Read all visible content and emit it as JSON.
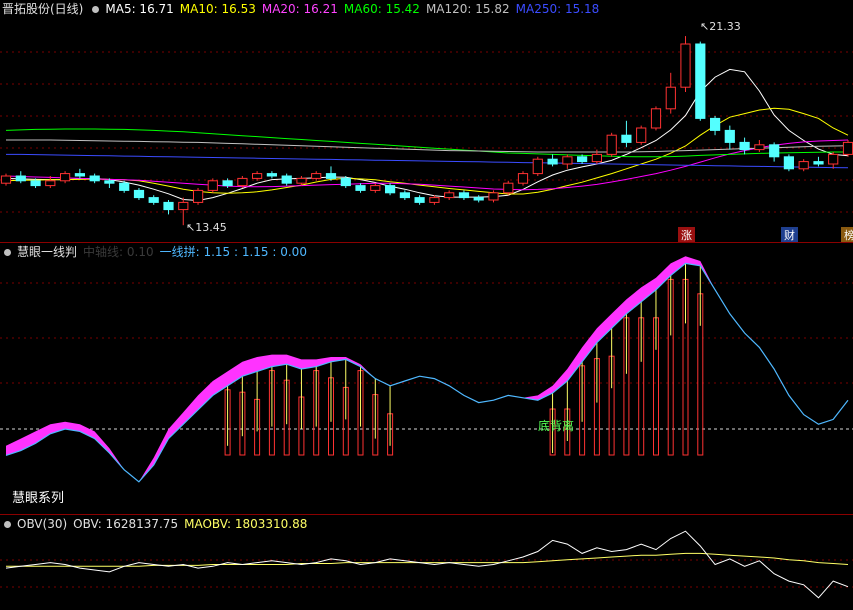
{
  "colors": {
    "up": "#ff3232",
    "down": "#54ffff",
    "ma5": "#ffffff",
    "ma10": "#ffff00",
    "ma20": "#ff00ff",
    "ma60": "#00ff00",
    "ma120": "#c0c0c0",
    "ma250": "#3b4cff",
    "obv": "#ffffff",
    "maobv": "#ffff66",
    "band": "#ff33ff",
    "ind_line": "#4fb8ff"
  },
  "main": {
    "stock_name": "晋拓股份(日线)",
    "indicators": [
      {
        "label": "MA5: 16.71",
        "color": "#ffffff"
      },
      {
        "label": "MA10: 16.53",
        "color": "#ffff00"
      },
      {
        "label": "MA20: 16.21",
        "color": "#ff44ff"
      },
      {
        "label": "MA60: 15.42",
        "color": "#00ff00"
      },
      {
        "label": "MA120: 15.82",
        "color": "#c0c0c0"
      },
      {
        "label": "MA250: 15.18",
        "color": "#3b4cff"
      }
    ],
    "high_label": "21.33",
    "low_label": "13.45",
    "tags": [
      "涨",
      "财",
      "榜"
    ]
  },
  "indicator": {
    "title": "慧眼一线判",
    "faded": "中轴线: 0.10",
    "value": "一线拼: 1.15 : 1.15 : 0.00",
    "signal": "底背离",
    "series_label": "慧眼系列"
  },
  "obv": {
    "title": "OBV(30)",
    "obv_value": "OBV: 1628137.75",
    "maobv_value": "MAOBV: 1803310.88"
  },
  "chart_data": {
    "type": "candlestick",
    "price_range": [
      13.0,
      22.0
    ],
    "candles": [
      [
        15.2,
        15.5,
        15.6,
        15.1
      ],
      [
        15.5,
        15.3,
        15.7,
        15.2
      ],
      [
        15.3,
        15.1,
        15.4,
        15.0
      ],
      [
        15.1,
        15.3,
        15.5,
        15.0
      ],
      [
        15.3,
        15.6,
        15.7,
        15.2
      ],
      [
        15.6,
        15.5,
        15.8,
        15.4
      ],
      [
        15.5,
        15.3,
        15.6,
        15.2
      ],
      [
        15.3,
        15.2,
        15.4,
        15.0
      ],
      [
        15.2,
        14.9,
        15.3,
        14.8
      ],
      [
        14.9,
        14.6,
        15.0,
        14.5
      ],
      [
        14.6,
        14.4,
        14.7,
        14.3
      ],
      [
        14.4,
        14.1,
        14.5,
        13.9
      ],
      [
        14.1,
        14.4,
        14.6,
        13.45
      ],
      [
        14.4,
        14.9,
        15.0,
        14.3
      ],
      [
        14.9,
        15.3,
        15.4,
        14.8
      ],
      [
        15.3,
        15.1,
        15.4,
        15.0
      ],
      [
        15.1,
        15.4,
        15.5,
        15.0
      ],
      [
        15.4,
        15.6,
        15.7,
        15.3
      ],
      [
        15.6,
        15.5,
        15.7,
        15.4
      ],
      [
        15.5,
        15.2,
        15.6,
        15.1
      ],
      [
        15.2,
        15.4,
        15.5,
        15.1
      ],
      [
        15.4,
        15.6,
        15.7,
        15.3
      ],
      [
        15.6,
        15.4,
        15.9,
        15.3
      ],
      [
        15.4,
        15.1,
        15.5,
        15.0
      ],
      [
        15.1,
        14.9,
        15.2,
        14.8
      ],
      [
        14.9,
        15.1,
        15.2,
        14.8
      ],
      [
        15.1,
        14.8,
        15.2,
        14.7
      ],
      [
        14.8,
        14.6,
        14.9,
        14.5
      ],
      [
        14.6,
        14.4,
        14.7,
        14.3
      ],
      [
        14.4,
        14.6,
        14.7,
        14.3
      ],
      [
        14.6,
        14.8,
        14.9,
        14.5
      ],
      [
        14.8,
        14.6,
        14.9,
        14.5
      ],
      [
        14.6,
        14.5,
        14.7,
        14.4
      ],
      [
        14.5,
        14.8,
        14.9,
        14.4
      ],
      [
        14.8,
        15.2,
        15.3,
        14.7
      ],
      [
        15.2,
        15.6,
        15.7,
        15.1
      ],
      [
        15.6,
        16.2,
        16.3,
        15.5
      ],
      [
        16.2,
        16.0,
        16.4,
        15.9
      ],
      [
        16.0,
        16.3,
        16.4,
        15.8
      ],
      [
        16.3,
        16.1,
        16.4,
        16.0
      ],
      [
        16.1,
        16.4,
        16.6,
        16.0
      ],
      [
        16.4,
        17.2,
        17.3,
        16.3
      ],
      [
        17.2,
        16.9,
        17.8,
        16.7
      ],
      [
        16.9,
        17.5,
        17.6,
        16.8
      ],
      [
        17.5,
        18.3,
        18.4,
        17.4
      ],
      [
        18.3,
        19.2,
        19.8,
        18.1
      ],
      [
        19.2,
        21.0,
        21.33,
        19.0
      ],
      [
        21.0,
        17.9,
        21.1,
        17.8
      ],
      [
        17.9,
        17.4,
        18.0,
        17.2
      ],
      [
        17.4,
        16.9,
        17.6,
        16.6
      ],
      [
        16.9,
        16.6,
        17.1,
        16.4
      ],
      [
        16.6,
        16.8,
        17.0,
        16.5
      ],
      [
        16.8,
        16.3,
        16.9,
        16.1
      ],
      [
        16.3,
        15.8,
        16.4,
        15.7
      ],
      [
        15.8,
        16.1,
        16.2,
        15.7
      ],
      [
        16.1,
        16.0,
        16.3,
        15.9
      ],
      [
        16.0,
        16.4,
        16.5,
        15.8
      ],
      [
        16.4,
        16.9,
        17.0,
        16.3
      ]
    ],
    "series": [
      {
        "name": "MA5",
        "values": [
          15.4,
          15.38,
          15.36,
          15.35,
          15.34,
          15.38,
          15.4,
          15.35,
          15.25,
          15.12,
          14.95,
          14.76,
          14.52,
          14.48,
          14.6,
          14.78,
          14.98,
          15.2,
          15.35,
          15.38,
          15.4,
          15.42,
          15.46,
          15.45,
          15.35,
          15.23,
          15.07,
          14.95,
          14.8,
          14.68,
          14.62,
          14.62,
          14.62,
          14.64,
          14.7,
          14.94,
          15.26,
          15.54,
          15.74,
          15.88,
          16.0,
          16.15,
          16.4,
          16.68,
          16.98,
          17.42,
          18.02,
          19.02,
          19.62,
          19.94,
          19.84,
          19.04,
          18.04,
          17.4,
          16.98,
          16.62,
          16.4,
          16.34
        ]
      },
      {
        "name": "MA10",
        "values": [
          15.3,
          15.32,
          15.33,
          15.34,
          15.35,
          15.36,
          15.37,
          15.36,
          15.34,
          15.3,
          15.2,
          15.08,
          14.95,
          14.86,
          14.8,
          14.78,
          14.8,
          14.84,
          14.92,
          15.02,
          15.12,
          15.25,
          15.36,
          15.4,
          15.38,
          15.34,
          15.26,
          15.2,
          15.12,
          15.05,
          14.98,
          14.92,
          14.86,
          14.8,
          14.75,
          14.75,
          14.82,
          14.95,
          15.1,
          15.24,
          15.42,
          15.6,
          15.8,
          16.0,
          16.2,
          16.45,
          16.75,
          17.2,
          17.6,
          17.95,
          18.1,
          18.25,
          18.32,
          18.28,
          18.1,
          17.9,
          17.5,
          17.2
        ]
      },
      {
        "name": "MA20",
        "values": [
          15.5,
          15.48,
          15.46,
          15.44,
          15.42,
          15.4,
          15.38,
          15.36,
          15.34,
          15.32,
          15.28,
          15.24,
          15.2,
          15.16,
          15.12,
          15.08,
          15.06,
          15.05,
          15.06,
          15.08,
          15.1,
          15.12,
          15.14,
          15.16,
          15.18,
          15.2,
          15.2,
          15.18,
          15.16,
          15.12,
          15.08,
          15.04,
          15.0,
          14.96,
          14.94,
          14.93,
          14.94,
          14.97,
          15.02,
          15.08,
          15.15,
          15.25,
          15.36,
          15.48,
          15.6,
          15.74,
          15.9,
          16.08,
          16.26,
          16.42,
          16.56,
          16.68,
          16.78,
          16.86,
          16.92,
          16.96,
          16.98,
          17.0
        ]
      },
      {
        "name": "MA60",
        "values": [
          17.4,
          17.42,
          17.44,
          17.45,
          17.46,
          17.46,
          17.46,
          17.45,
          17.44,
          17.42,
          17.4,
          17.37,
          17.34,
          17.3,
          17.26,
          17.22,
          17.18,
          17.14,
          17.1,
          17.06,
          17.02,
          16.98,
          16.94,
          16.9,
          16.86,
          16.82,
          16.78,
          16.74,
          16.7,
          16.66,
          16.62,
          16.58,
          16.54,
          16.5,
          16.46,
          16.44,
          16.42,
          16.4,
          16.38,
          16.36,
          16.34,
          16.32,
          16.31,
          16.3,
          16.3,
          16.31,
          16.33,
          16.36,
          16.38,
          16.4,
          16.42,
          16.44,
          16.46,
          16.47,
          16.48,
          16.49,
          16.5,
          16.5
        ]
      },
      {
        "name": "MA120",
        "values": [
          17.0,
          17.0,
          17.0,
          17.0,
          16.99,
          16.98,
          16.97,
          16.96,
          16.95,
          16.94,
          16.93,
          16.92,
          16.91,
          16.9,
          16.88,
          16.86,
          16.84,
          16.82,
          16.8,
          16.78,
          16.76,
          16.74,
          16.72,
          16.7,
          16.68,
          16.66,
          16.64,
          16.62,
          16.6,
          16.58,
          16.56,
          16.55,
          16.54,
          16.53,
          16.52,
          16.51,
          16.5,
          16.5,
          16.5,
          16.5,
          16.5,
          16.5,
          16.5,
          16.51,
          16.52,
          16.54,
          16.56,
          16.58,
          16.6,
          16.62,
          16.64,
          16.66,
          16.68,
          16.7,
          16.72,
          16.74,
          16.75,
          16.76
        ]
      },
      {
        "name": "MA250",
        "values": [
          16.4,
          16.4,
          16.39,
          16.38,
          16.37,
          16.36,
          16.35,
          16.34,
          16.33,
          16.32,
          16.31,
          16.3,
          16.29,
          16.28,
          16.27,
          16.26,
          16.25,
          16.24,
          16.23,
          16.22,
          16.21,
          16.2,
          16.19,
          16.18,
          16.17,
          16.16,
          16.15,
          16.14,
          16.13,
          16.12,
          16.11,
          16.1,
          16.09,
          16.08,
          16.07,
          16.06,
          16.05,
          16.04,
          16.03,
          16.02,
          16.01,
          16.0,
          15.99,
          15.98,
          15.97,
          15.96,
          15.95,
          15.94,
          15.93,
          15.92,
          15.91,
          15.9,
          15.89,
          15.88,
          15.87,
          15.86,
          15.85,
          15.84
        ]
      }
    ],
    "indicator_range": [
      0,
      10
    ],
    "indicator_line": [
      1.9,
      2.1,
      2.4,
      2.8,
      3.0,
      2.9,
      2.6,
      2.0,
      1.3,
      0.8,
      1.5,
      2.6,
      3.2,
      3.8,
      4.4,
      4.8,
      5.2,
      5.4,
      5.6,
      5.7,
      5.5,
      5.6,
      5.8,
      5.9,
      5.6,
      5.1,
      4.8,
      5.0,
      5.2,
      5.1,
      4.8,
      4.4,
      4.1,
      4.2,
      4.4,
      4.3,
      4.2,
      4.5,
      5.0,
      5.8,
      6.6,
      7.2,
      7.8,
      8.3,
      8.8,
      9.4,
      9.9,
      9.8,
      8.8,
      7.8,
      7.0,
      6.4,
      5.5,
      4.4,
      3.6,
      3.2,
      3.4,
      4.2
    ],
    "indicator_band": [
      2.3,
      2.6,
      2.9,
      3.2,
      3.3,
      3.2,
      2.9,
      2.2,
      1.3,
      0.8,
      1.8,
      3.0,
      3.7,
      4.4,
      5.0,
      5.4,
      5.8,
      6.0,
      6.1,
      6.1,
      5.9,
      5.9,
      6.0,
      6.0,
      5.7,
      5.1,
      4.8,
      5.0,
      5.2,
      5.1,
      4.8,
      4.4,
      4.1,
      4.2,
      4.4,
      4.3,
      4.4,
      4.8,
      5.5,
      6.4,
      7.2,
      7.8,
      8.4,
      8.9,
      9.3,
      9.9,
      10.2,
      10.0,
      8.8,
      7.8,
      7.0,
      6.4,
      5.5,
      4.4,
      3.6,
      3.2,
      3.4,
      4.2
    ],
    "obv_range": [
      -2.0,
      2.0
    ],
    "obv": [
      0.1,
      0.2,
      0.3,
      0.4,
      0.3,
      0.1,
      0.0,
      -0.1,
      0.2,
      0.4,
      0.3,
      0.2,
      0.3,
      0.1,
      0.2,
      0.4,
      0.3,
      0.4,
      0.5,
      0.4,
      0.3,
      0.4,
      0.6,
      0.5,
      0.3,
      0.4,
      0.6,
      0.5,
      0.4,
      0.3,
      0.4,
      0.3,
      0.2,
      0.3,
      0.5,
      0.7,
      1.0,
      1.6,
      1.4,
      0.9,
      1.2,
      1.0,
      1.1,
      1.4,
      1.1,
      1.7,
      2.1,
      1.3,
      0.3,
      0.6,
      0.2,
      0.5,
      -0.2,
      -0.6,
      -0.8,
      -1.5,
      -0.6,
      -0.9
    ],
    "maobv": [
      0.2,
      0.2,
      0.2,
      0.2,
      0.2,
      0.2,
      0.2,
      0.2,
      0.2,
      0.2,
      0.25,
      0.25,
      0.25,
      0.25,
      0.3,
      0.3,
      0.3,
      0.3,
      0.3,
      0.3,
      0.35,
      0.35,
      0.35,
      0.4,
      0.4,
      0.4,
      0.4,
      0.4,
      0.4,
      0.4,
      0.4,
      0.4,
      0.4,
      0.4,
      0.4,
      0.4,
      0.45,
      0.5,
      0.55,
      0.6,
      0.65,
      0.7,
      0.75,
      0.8,
      0.8,
      0.85,
      0.9,
      0.9,
      0.85,
      0.8,
      0.75,
      0.7,
      0.65,
      0.55,
      0.5,
      0.4,
      0.35,
      0.3
    ]
  }
}
